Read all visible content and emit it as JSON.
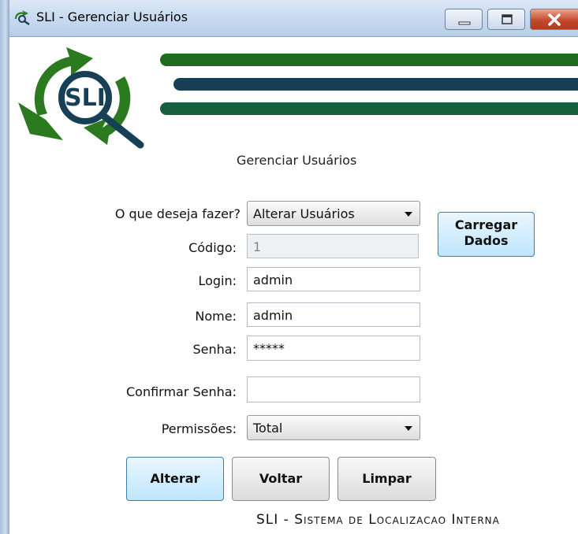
{
  "window": {
    "title": "SLI - Gerenciar Usuários",
    "controls": [
      "minimize",
      "maximize",
      "close"
    ]
  },
  "logo": {
    "text": "SLI",
    "icon": "sli-magnifier-recycle-logo"
  },
  "form": {
    "heading": "Gerenciar Usuários",
    "action": {
      "label": "O que deseja fazer?",
      "selected": "Alterar Usuários"
    },
    "codigo": {
      "label": "Código:",
      "value": "1"
    },
    "login": {
      "label": "Login:",
      "value": "admin"
    },
    "nome": {
      "label": "Nome:",
      "value": "admin"
    },
    "senha": {
      "label": "Senha:",
      "value": "*****"
    },
    "confirmar_senha": {
      "label": "Confirmar Senha:",
      "value": ""
    },
    "permissoes": {
      "label": "Permissões:",
      "selected": "Total"
    }
  },
  "buttons": {
    "carregar_line1": "Carregar",
    "carregar_line2": "Dados",
    "alterar": "Alterar",
    "voltar": "Voltar",
    "limpar": "Limpar"
  },
  "footer": "SLI - Sistema de Localizacao Interna",
  "colors": {
    "stripe_top": "#1f6b1f",
    "stripe_middle": "#173f55",
    "stripe_bottom": "#17603d",
    "logo_green": "#2b7a1f",
    "logo_dark": "#173f55"
  }
}
